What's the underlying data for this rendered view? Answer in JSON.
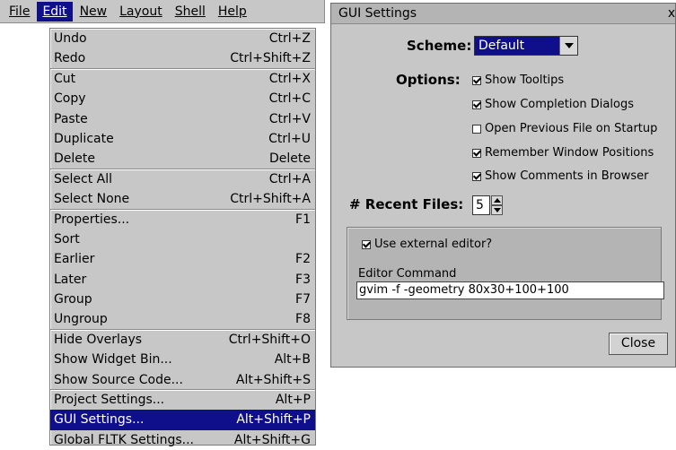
{
  "menubar": {
    "items": [
      {
        "label": "File"
      },
      {
        "label": "Edit"
      },
      {
        "label": "New"
      },
      {
        "label": "Layout"
      },
      {
        "label": "Shell"
      },
      {
        "label": "Help"
      }
    ]
  },
  "edit_menu": {
    "items": [
      {
        "label": "Undo",
        "shortcut": "Ctrl+Z"
      },
      {
        "label": "Redo",
        "shortcut": "Ctrl+Shift+Z"
      },
      {
        "label": "Cut",
        "shortcut": "Ctrl+X"
      },
      {
        "label": "Copy",
        "shortcut": "Ctrl+C"
      },
      {
        "label": "Paste",
        "shortcut": "Ctrl+V"
      },
      {
        "label": "Duplicate",
        "shortcut": "Ctrl+U"
      },
      {
        "label": "Delete",
        "shortcut": "Delete"
      },
      {
        "label": "Select All",
        "shortcut": "Ctrl+A"
      },
      {
        "label": "Select None",
        "shortcut": "Ctrl+Shift+A"
      },
      {
        "label": "Properties...",
        "shortcut": "F1"
      },
      {
        "label": "Sort",
        "shortcut": ""
      },
      {
        "label": "Earlier",
        "shortcut": "F2"
      },
      {
        "label": "Later",
        "shortcut": "F3"
      },
      {
        "label": "Group",
        "shortcut": "F7"
      },
      {
        "label": "Ungroup",
        "shortcut": "F8"
      },
      {
        "label": "Hide Overlays",
        "shortcut": "Ctrl+Shift+O"
      },
      {
        "label": "Show Widget Bin...",
        "shortcut": "Alt+B"
      },
      {
        "label": "Show Source Code...",
        "shortcut": "Alt+Shift+S"
      },
      {
        "label": "Project Settings...",
        "shortcut": "Alt+P"
      },
      {
        "label": "GUI Settings...",
        "shortcut": "Alt+Shift+P"
      },
      {
        "label": "Global FLTK Settings...",
        "shortcut": "Alt+Shift+G"
      }
    ]
  },
  "dialog": {
    "title": "GUI Settings",
    "close_glyph": "x",
    "scheme_label": "Scheme:",
    "scheme_value": "Default",
    "options_label": "Options:",
    "options": [
      {
        "label": "Show Tooltips",
        "checked": true
      },
      {
        "label": "Show Completion Dialogs",
        "checked": true
      },
      {
        "label": "Open Previous File on Startup",
        "checked": false
      },
      {
        "label": "Remember Window Positions",
        "checked": true
      },
      {
        "label": "Show Comments in Browser",
        "checked": true
      }
    ],
    "recent_files_label": "# Recent Files:",
    "recent_files_value": "5",
    "external_editor_label": "Use external editor?",
    "external_editor_checked": true,
    "editor_command_label": "Editor Command",
    "editor_command_value": "gvim -f -geometry 80x30+100+100",
    "close_button": "Close"
  },
  "colors": {
    "selection": "#0f0f8c",
    "panel": "#c7c7c7"
  }
}
